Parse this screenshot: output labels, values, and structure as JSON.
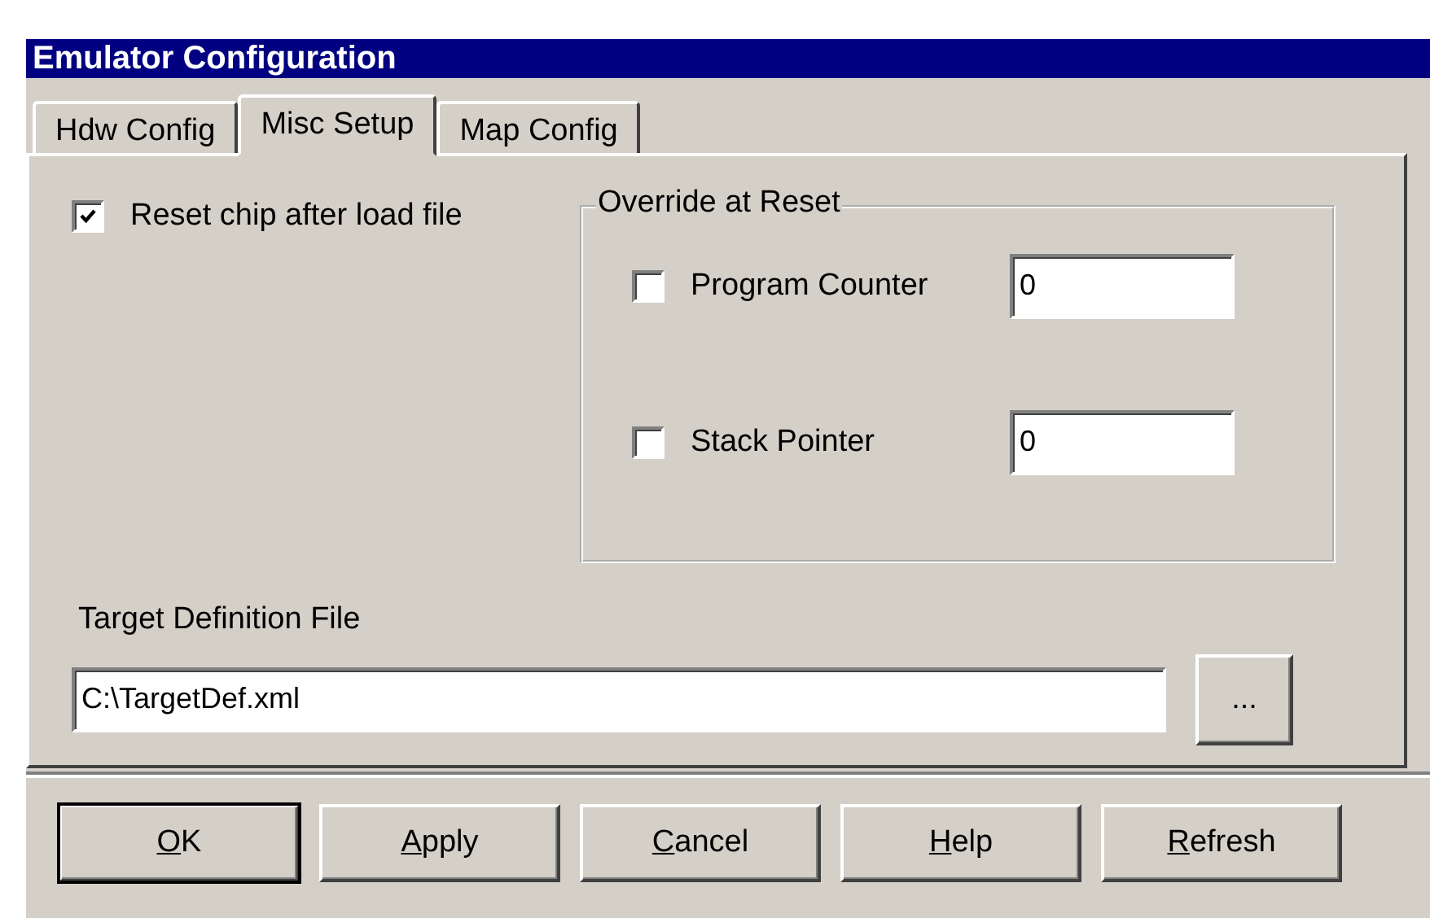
{
  "window": {
    "title": "Emulator Configuration"
  },
  "tabs": [
    {
      "label": "Hdw Config",
      "selected": false
    },
    {
      "label": "Misc Setup",
      "selected": true
    },
    {
      "label": "Map Config",
      "selected": false
    }
  ],
  "reset_chip": {
    "label": "Reset chip after load file",
    "checked": true
  },
  "override_group": {
    "title": "Override at Reset",
    "rows": [
      {
        "label": "Program Counter",
        "checked": false,
        "value": "0"
      },
      {
        "label": "Stack Pointer",
        "checked": false,
        "value": "0"
      }
    ]
  },
  "target_file": {
    "label": "Target Definition File",
    "value": "C:\\TargetDef.xml",
    "browse": "..."
  },
  "buttons": [
    {
      "label": "OK",
      "default": true
    },
    {
      "label": "Apply",
      "default": false
    },
    {
      "label": "Cancel",
      "default": false
    },
    {
      "label": "Help",
      "default": false
    },
    {
      "label": "Refresh",
      "default": false
    }
  ]
}
